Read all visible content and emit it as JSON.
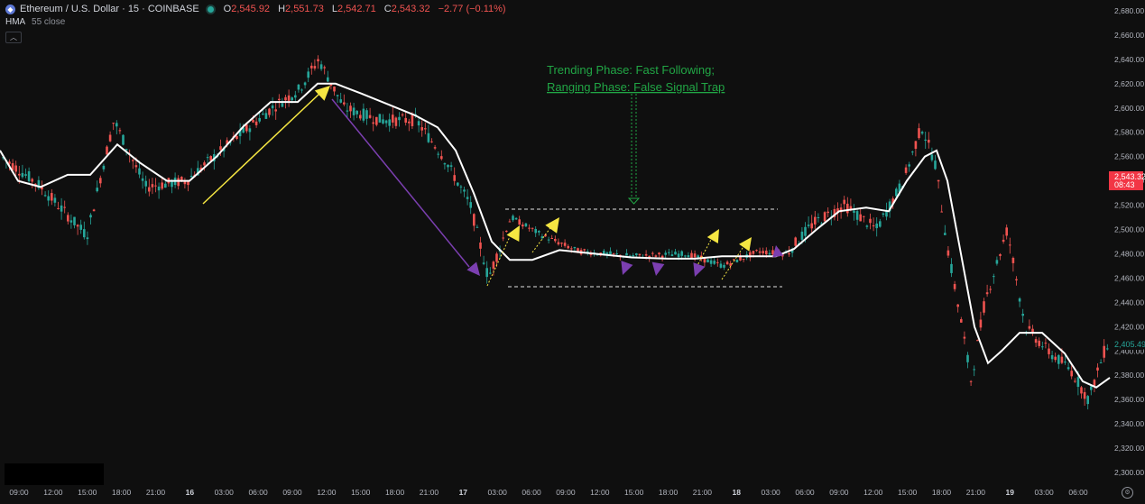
{
  "legend": {
    "symbol": "Ethereum / U.S. Dollar · 15 · COINBASE",
    "ohlc": [
      {
        "label": "O",
        "value": "2,545.92"
      },
      {
        "label": "H",
        "value": "2,551.73"
      },
      {
        "label": "L",
        "value": "2,542.71"
      },
      {
        "label": "C",
        "value": "2,543.32"
      }
    ],
    "change": "−2.77 (−0.11%)",
    "indicator_name": "HMA",
    "indicator_params": "55 close"
  },
  "annotation": {
    "line1": "Trending Phase: Fast Following;",
    "line2": "Ranging Phase: False Signal Trap"
  },
  "price_axis": {
    "ticks": [
      "2,680.00",
      "2,660.00",
      "2,640.00",
      "2,620.00",
      "2,600.00",
      "2,580.00",
      "2,560.00",
      "2,540.00",
      "2,520.00",
      "2,500.00",
      "2,480.00",
      "2,460.00",
      "2,440.00",
      "2,420.00",
      "2,400.00",
      "2,380.00",
      "2,360.00",
      "2,340.00",
      "2,320.00",
      "2,300.00"
    ],
    "current_price": "2,543.32",
    "countdown": "08:43",
    "hma_value": "2,405.49"
  },
  "time_axis": {
    "labels": [
      "09:00",
      "12:00",
      "15:00",
      "18:00",
      "21:00",
      "16",
      "03:00",
      "06:00",
      "09:00",
      "12:00",
      "15:00",
      "18:00",
      "21:00",
      "17",
      "03:00",
      "06:00",
      "09:00",
      "12:00",
      "15:00",
      "18:00",
      "21:00",
      "18",
      "03:00",
      "06:00",
      "09:00",
      "12:00",
      "15:00",
      "18:00",
      "21:00",
      "19",
      "03:00",
      "06:00"
    ]
  },
  "colors": {
    "background": "#0f0f0f",
    "up": "#26a69a",
    "down": "#ef5350",
    "hma": "#ffffff",
    "arrow_trend": "#f5e642",
    "arrow_down": "#7b3fb0",
    "annotation": "#21a645",
    "current_price_bg": "#f23645"
  }
}
